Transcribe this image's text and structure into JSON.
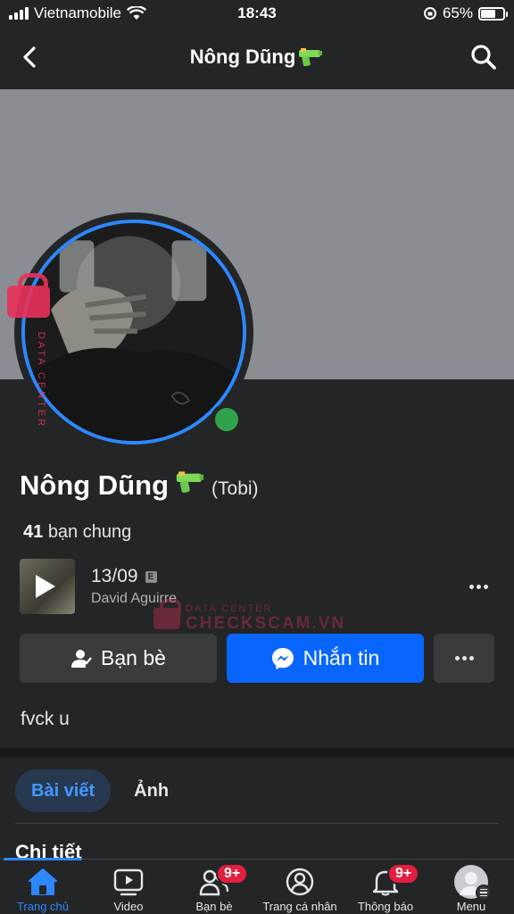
{
  "status_bar": {
    "carrier": "Vietnamobile",
    "time": "18:43",
    "battery": "65%",
    "battery_level": 0.65
  },
  "header": {
    "title": "Nông Dũng",
    "title_emoji_icon": "water-pistol-icon"
  },
  "profile": {
    "name": "Nông Dũng",
    "nickname": "(Tobi)",
    "mutual_count": "41",
    "mutual_label": "bạn chung",
    "online": true,
    "bio": "fvck u"
  },
  "music": {
    "title": "13/09",
    "explicit_label": "E",
    "artist": "David Aguirre"
  },
  "actions": {
    "friend_label": "Bạn bè",
    "message_label": "Nhắn tin"
  },
  "tabs": [
    {
      "label": "Bài viết",
      "active": true
    },
    {
      "label": "Ảnh",
      "active": false
    }
  ],
  "section_title": "Chi tiết",
  "bottom_nav": [
    {
      "label": "Trang chủ",
      "icon": "home-icon",
      "active": true
    },
    {
      "label": "Video",
      "icon": "video-icon",
      "active": false
    },
    {
      "label": "Bạn bè",
      "icon": "friends-icon",
      "badge": "9+"
    },
    {
      "label": "Trang cá nhân",
      "icon": "profile-icon"
    },
    {
      "label": "Thông báo",
      "icon": "bell-icon",
      "badge": "9+"
    },
    {
      "label": "Menu",
      "icon": "menu-avatar"
    }
  ],
  "watermark": {
    "text": "CHECKSCAM.VN",
    "subtext": "DATA CENTER"
  },
  "colors": {
    "accent": "#2d88ff",
    "message_button": "#0866ff",
    "online": "#31a24c",
    "badge": "#e41e3f",
    "background": "#242526"
  }
}
